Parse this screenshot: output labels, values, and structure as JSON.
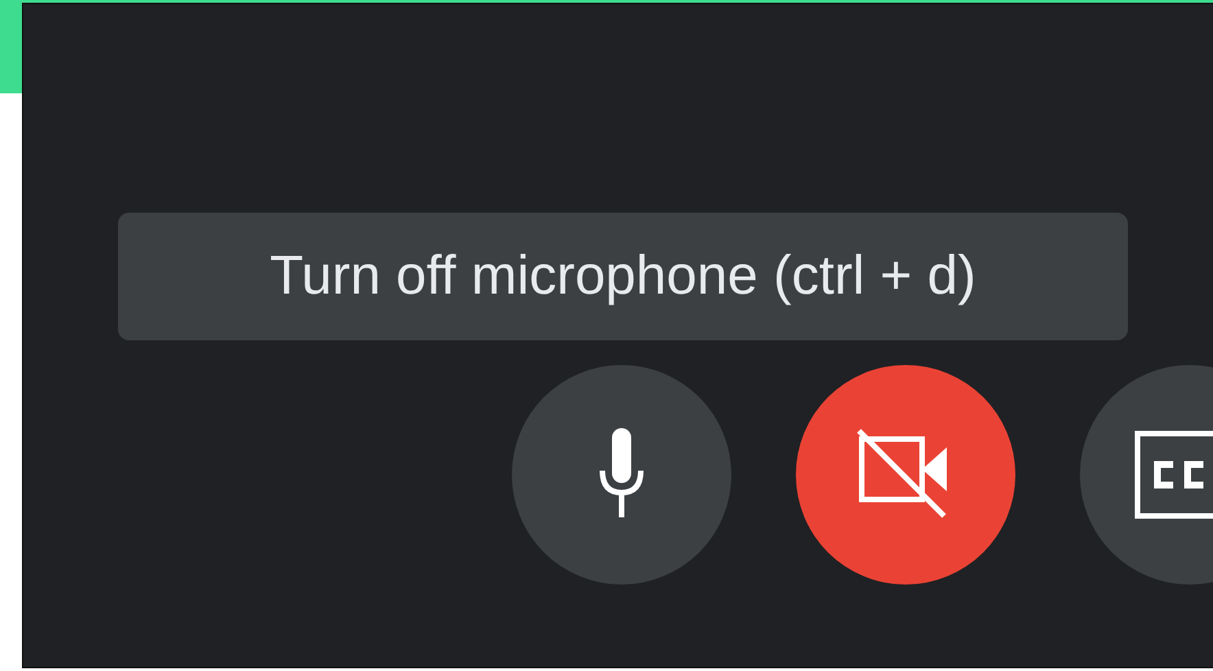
{
  "tooltip": {
    "text": "Turn off microphone (ctrl + d)"
  },
  "buttons": [
    {
      "kind": "microphone",
      "on": true
    },
    {
      "kind": "camera",
      "on": false
    },
    {
      "kind": "captions"
    }
  ]
}
